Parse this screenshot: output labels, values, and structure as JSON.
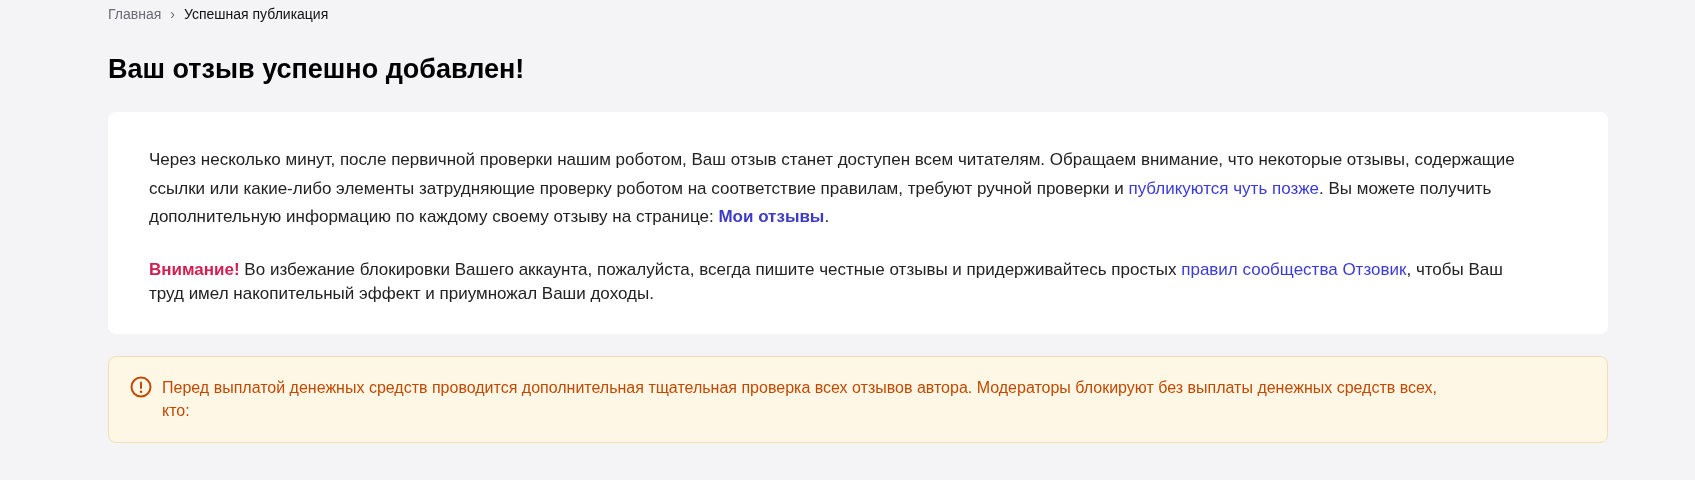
{
  "breadcrumbs": {
    "items": [
      {
        "label": "Главная",
        "kind": "link"
      },
      {
        "label": "Успешная публикация",
        "kind": "current"
      }
    ],
    "separator": "›"
  },
  "title": "Ваш отзыв успешно добавлен!",
  "notice": {
    "paragraphs": [
      [
        {
          "kind": "text",
          "text": "Через несколько минут, после первичной проверки нашим роботом, Ваш отзыв станет доступен всем читателям. Обращаем внимание, что некоторые отзывы, содержащие ссылки или какие-либо элементы затрудняющие проверку роботом на соответствие правилам, требуют ручной проверки и "
        },
        {
          "kind": "link",
          "text": "публикуются чуть позже"
        },
        {
          "kind": "text",
          "text": ". Вы можете получить дополнительную информацию по каждому своему отзыву на странице: "
        },
        {
          "kind": "strong-link",
          "text": "Мои отзывы"
        },
        {
          "kind": "text",
          "text": "."
        }
      ],
      [
        {
          "kind": "alert",
          "text": "Внимание!"
        },
        {
          "kind": "text",
          "text": " Во избежание блокировки Вашего аккаунта, пожалуйста, всегда пишите честные отзывы и придерживайтесь простых "
        },
        {
          "kind": "link",
          "text": "правил сообщества Отзовик"
        },
        {
          "kind": "text",
          "text": ", чтобы Ваш труд имел накопительный эффект и приумножал Ваши доходы."
        }
      ]
    ]
  },
  "warning": {
    "text": "Перед выплатой денежных средств проводится дополнительная тщательная проверка всех отзывов автора. Модераторы блокируют без выплаты денежных средств всех, кто:"
  }
}
